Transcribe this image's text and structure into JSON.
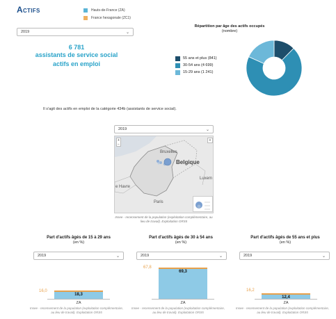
{
  "header": {
    "title": "Actifs"
  },
  "legend": [
    {
      "label": "Hauts-de-France (ZA)",
      "color": "#5ab4d6"
    },
    {
      "label": "France hexagonale (ZC1)",
      "color": "#f0b060"
    }
  ],
  "year_select": {
    "value": "2019"
  },
  "kpi": {
    "number": "6 781",
    "line1": "assistants de service social",
    "line2": "actifs en emploi"
  },
  "repartition": {
    "title": "Répartition par âge des actifs occupés",
    "subtitle": "(nombre)",
    "items": [
      {
        "label": "55 ans et plus (841)",
        "color": "#1d4e6b",
        "value": 841
      },
      {
        "label": "30-54 ans (4 699)",
        "color": "#2e8fb4",
        "value": 4699
      },
      {
        "label": "15-29 ans (1 241)",
        "color": "#6cb8d9",
        "value": 1241
      }
    ]
  },
  "description": "Il s'agit des actifs en emploi de la catégorie 434b (assistants de service social).",
  "map": {
    "select_value": "2019",
    "labels": {
      "bruxelles": "Bruxelles",
      "belgique": "Belgique",
      "luxembourg": "Luxem",
      "havre": "e Havre",
      "paris": "Paris"
    },
    "note": "Insee - recensement de la population (exploitation complémentaire, au lieu de travail). Exploitation ORS5"
  },
  "charts": [
    {
      "title": "Part d'actifs âgés de 15 à 29 ans",
      "unit": "(en %)",
      "select": "2019",
      "ref_label": "16,0",
      "category": "ZA",
      "bar_label": "18,3",
      "note": "Insee - recensement de la population (exploitation complémentaire, au lieu de travail). Exploitation ORS5"
    },
    {
      "title": "Part d'actifs âgés de 30 à 54 ans",
      "unit": "(en %)",
      "select": "2019",
      "ref_label": "67,8",
      "category": "ZA",
      "bar_label": "69,3",
      "note": "Insee - recensement de la population (exploitation complémentaire, au lieu de travail). Exploitation ORS5"
    },
    {
      "title": "Part d'actifs âgés de 55 ans et plus",
      "unit": "(en %)",
      "select": "2019",
      "ref_label": "16,2",
      "category": "ZA",
      "bar_label": "12,4",
      "note": "Insee - recensement de la population (exploitation complémentaire, au lieu de travail). Exploitation ORS5"
    }
  ],
  "chart_data": [
    {
      "type": "pie",
      "title": "Répartition par âge des actifs occupés",
      "categories": [
        "55 ans et plus",
        "30-54 ans",
        "15-29 ans"
      ],
      "values": [
        841,
        4699,
        1241
      ]
    },
    {
      "type": "bar",
      "title": "Part d'actifs âgés de 15 à 29 ans",
      "ylabel": "(en %)",
      "categories": [
        "ZA"
      ],
      "series": [
        {
          "name": "Hauts-de-France (ZA)",
          "values": [
            18.3
          ]
        },
        {
          "name": "France hexagonale (ZC1)",
          "values": [
            16.0
          ]
        }
      ],
      "ylim": [
        0,
        80
      ]
    },
    {
      "type": "bar",
      "title": "Part d'actifs âgés de 30 à 54 ans",
      "ylabel": "(en %)",
      "categories": [
        "ZA"
      ],
      "series": [
        {
          "name": "Hauts-de-France (ZA)",
          "values": [
            69.3
          ]
        },
        {
          "name": "France hexagonale (ZC1)",
          "values": [
            67.8
          ]
        }
      ],
      "ylim": [
        0,
        80
      ]
    },
    {
      "type": "bar",
      "title": "Part d'actifs âgés de 55 ans et plus",
      "ylabel": "(en %)",
      "categories": [
        "ZA"
      ],
      "series": [
        {
          "name": "Hauts-de-France (ZA)",
          "values": [
            12.4
          ]
        },
        {
          "name": "France hexagonale (ZC1)",
          "values": [
            16.2
          ]
        }
      ],
      "ylim": [
        0,
        80
      ]
    }
  ]
}
